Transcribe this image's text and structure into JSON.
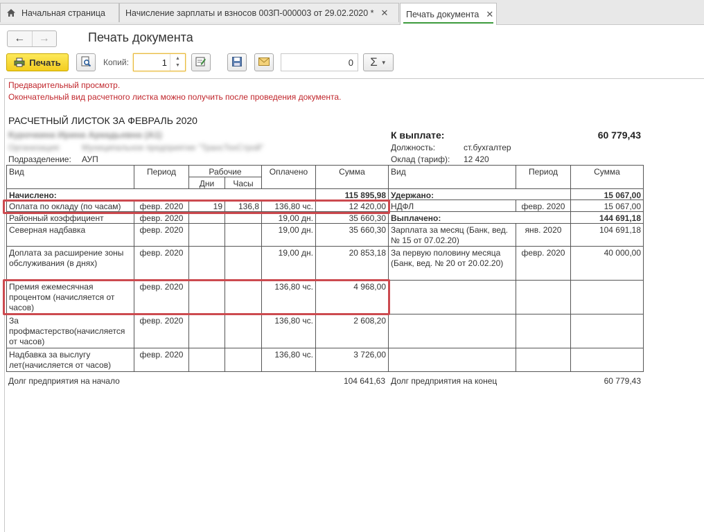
{
  "tabs": [
    {
      "label": "Начальная страница"
    },
    {
      "label": "Начисление зарплаты и взносов 003П-000003 от 29.02.2020 *"
    },
    {
      "label": "Печать документа"
    }
  ],
  "title": "Печать документа",
  "toolbar": {
    "print_label": "Печать",
    "copies_label": "Копий:",
    "copies_value": "1",
    "number_value": "0",
    "sum_symbol": "Σ"
  },
  "notice": {
    "line1": "Предварительный просмотр.",
    "line2": "Окончательный вид расчетного листка можно получить после проведения документа."
  },
  "sheet": {
    "title": "РАСЧЕТНЫЙ ЛИСТОК ЗА ФЕВРАЛЬ 2020",
    "employee_name": "Курочкина Ирина Аркадьевна (А1)",
    "org_label": "Организация:",
    "org_value": "Муниципальное предприятие \"ТрансТехСтрой\"",
    "dept_label": "Подразделение:",
    "dept_value": "АУП",
    "payout_label": "К выплате:",
    "payout_value": "60 779,43",
    "position_label": "Должность:",
    "position_value": "ст.бухгалтер",
    "rate_label": "Оклад (тариф):",
    "rate_value": "12 420"
  },
  "table": {
    "headers": {
      "vid": "Вид",
      "period": "Период",
      "working": "Рабочие",
      "days": "Дни",
      "hours": "Часы",
      "paid": "Оплачено",
      "sum": "Сумма",
      "r_vid": "Вид",
      "r_period": "Период",
      "r_sum": "Сумма"
    },
    "accrued_label": "Начислено:",
    "accrued_total": "115 895,98",
    "withheld_label": "Удержано:",
    "withheld_total": "15 067,00",
    "paid_label": "Выплачено:",
    "paid_total": "144 691,18",
    "accruals": [
      {
        "name": "Оплата по окладу (по часам)",
        "period": "февр. 2020",
        "days": "19",
        "hours": "136,8",
        "paid": "136,80 чс.",
        "sum": "12 420,00"
      },
      {
        "name": "Районный коэффициент",
        "period": "февр. 2020",
        "days": "",
        "hours": "",
        "paid": "19,00 дн.",
        "sum": "35 660,30"
      },
      {
        "name": "Северная надбавка",
        "period": "февр. 2020",
        "days": "",
        "hours": "",
        "paid": "19,00 дн.",
        "sum": "35 660,30"
      },
      {
        "name": "Доплата за расширение зоны обслуживания (в днях)",
        "period": "февр. 2020",
        "days": "",
        "hours": "",
        "paid": "19,00 дн.",
        "sum": "20 853,18"
      },
      {
        "name": "Премия ежемесячная процентом (начисляется от часов)",
        "period": "февр. 2020",
        "days": "",
        "hours": "",
        "paid": "136,80 чс.",
        "sum": "4 968,00"
      },
      {
        "name": "За профмастерство(начисляется от часов)",
        "period": "февр. 2020",
        "days": "",
        "hours": "",
        "paid": "136,80 чс.",
        "sum": "2 608,20"
      },
      {
        "name": "Надбавка за выслугу лет(начисляется от часов)",
        "period": "февр. 2020",
        "days": "",
        "hours": "",
        "paid": "136,80 чс.",
        "sum": "3 726,00"
      }
    ],
    "withholdings": [
      {
        "name": "НДФЛ",
        "period": "февр. 2020",
        "sum": "15 067,00"
      }
    ],
    "payments": [
      {
        "name": "Зарплата за месяц (Банк, вед. № 15 от 07.02.20)",
        "period": "янв. 2020",
        "sum": "104 691,18"
      },
      {
        "name": "За первую половину месяца (Банк, вед. № 20 от 20.02.20)",
        "period": "февр. 2020",
        "sum": "40 000,00"
      }
    ],
    "debt_start_label": "Долг предприятия на начало",
    "debt_start_value": "104 641,63",
    "debt_end_label": "Долг предприятия на конец",
    "debt_end_value": "60 779,43"
  },
  "colors": {
    "highlight": "#cc4a4f",
    "notice": "#c0262c",
    "print_button": "#f3cd1f"
  },
  "icons": [
    "home-icon",
    "close-icon",
    "back-arrow-icon",
    "forward-arrow-icon",
    "printer-icon",
    "preview-icon",
    "edit-icon",
    "save-icon",
    "mail-icon",
    "sigma-icon"
  ]
}
